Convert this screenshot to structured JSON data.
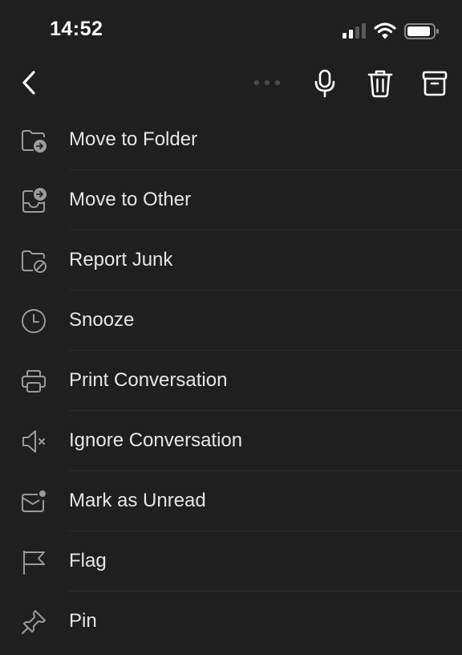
{
  "status_bar": {
    "time": "14:52",
    "icons": [
      "cellular-signal-icon",
      "wifi-icon",
      "battery-icon"
    ]
  },
  "nav_bar": {
    "icons": [
      "back-chevron-icon",
      "more-dots-icon",
      "microphone-icon",
      "trash-icon",
      "archive-icon"
    ]
  },
  "menu": {
    "items": [
      {
        "label": "Move to Folder",
        "icon": "folder-move-icon"
      },
      {
        "label": "Move to Other",
        "icon": "inbox-move-icon"
      },
      {
        "label": "Report Junk",
        "icon": "folder-block-icon"
      },
      {
        "label": "Snooze",
        "icon": "clock-icon"
      },
      {
        "label": "Print Conversation",
        "icon": "printer-icon"
      },
      {
        "label": "Ignore Conversation",
        "icon": "speaker-mute-icon"
      },
      {
        "label": "Mark as Unread",
        "icon": "envelope-unread-icon"
      },
      {
        "label": "Flag",
        "icon": "flag-icon"
      },
      {
        "label": "Pin",
        "icon": "pin-icon"
      }
    ]
  },
  "colors": {
    "background": "#1f1f1f",
    "text": "#e6e6e6",
    "icon": "#9a9a9a",
    "nav_icon": "#ffffff"
  }
}
